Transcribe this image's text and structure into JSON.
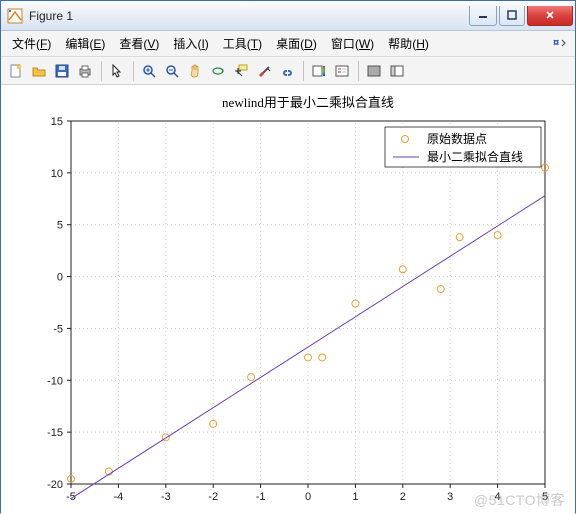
{
  "window": {
    "title": "Figure 1"
  },
  "menu": {
    "file": {
      "label": "文件",
      "key": "F"
    },
    "edit": {
      "label": "编辑",
      "key": "E"
    },
    "view": {
      "label": "查看",
      "key": "V"
    },
    "insert": {
      "label": "插入",
      "key": "I"
    },
    "tools": {
      "label": "工具",
      "key": "T"
    },
    "desktop": {
      "label": "桌面",
      "key": "D"
    },
    "window": {
      "label": "窗口",
      "key": "W"
    },
    "help": {
      "label": "帮助",
      "key": "H"
    }
  },
  "toolbar_icons": {
    "new": "new-file-icon",
    "open": "open-folder-icon",
    "save": "save-icon",
    "print": "print-icon",
    "pointer": "pointer-icon",
    "zoom_in": "zoom-in-icon",
    "zoom_out": "zoom-out-icon",
    "pan": "pan-hand-icon",
    "rotate": "rotate-3d-icon",
    "datacursor": "data-cursor-icon",
    "brush": "brush-icon",
    "link": "link-icon",
    "colorbar": "colorbar-icon",
    "legend": "legend-icon",
    "hide": "hide-panel-icon",
    "show": "show-panel-icon"
  },
  "chart_data": {
    "type": "scatter+line",
    "title": "newlind用于最小二乘拟合直线",
    "xlabel": "",
    "ylabel": "",
    "xlim": [
      -5,
      5
    ],
    "ylim": [
      -20,
      15
    ],
    "xticks": [
      -5,
      -4,
      -3,
      -2,
      -1,
      0,
      1,
      2,
      3,
      4,
      5
    ],
    "yticks": [
      -20,
      -15,
      -10,
      -5,
      0,
      5,
      10,
      15
    ],
    "series": [
      {
        "name": "原始数据点",
        "kind": "scatter",
        "marker": "o",
        "color": "#e6a23c",
        "x": [
          -5.0,
          -4.2,
          -3.0,
          -2.0,
          -1.2,
          0.0,
          0.3,
          1.0,
          2.0,
          2.8,
          3.2,
          4.0,
          5.0
        ],
        "y": [
          -19.5,
          -18.8,
          -15.5,
          -14.2,
          -9.7,
          -7.8,
          -7.8,
          -2.6,
          0.7,
          -1.2,
          3.8,
          4.0,
          10.5
        ]
      },
      {
        "name": "最小二乘拟合直线",
        "kind": "line",
        "color": "#6a3fb5",
        "x": [
          -5,
          5
        ],
        "y": [
          -21.4,
          7.8
        ]
      }
    ],
    "legend": {
      "position": "upper-right",
      "entries": [
        "原始数据点",
        "最小二乘拟合直线"
      ]
    }
  },
  "watermark": "@51CTO博客"
}
